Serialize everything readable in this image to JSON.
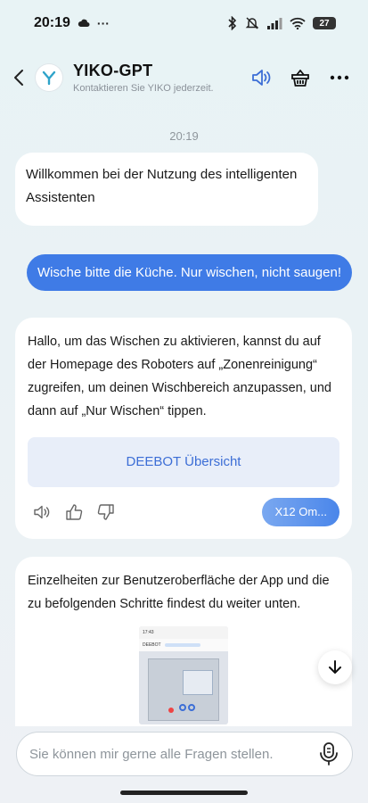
{
  "status_bar": {
    "time": "20:19",
    "battery": "27",
    "dots": "···"
  },
  "header": {
    "title": "YIKO-GPT",
    "subtitle": "Kontaktieren Sie YIKO jederzeit."
  },
  "chat": {
    "timestamp": "20:19",
    "welcome_message": "Willkommen bei der Nutzung des intelligenten Assistenten",
    "user_message": "Wische bitte die Küche. Nur wischen, nicht saugen!",
    "answer": {
      "text": "Hallo, um das Wischen zu aktivieren, kannst du auf der Homepage des Roboters auf „Zonenreinigung“ zugreifen, um deinen Wischbereich anzupassen, und dann auf „Nur Wischen“ tippen.",
      "link_card_label": "DEEBOT Übersicht",
      "device_pill": "X12 Om..."
    },
    "details": {
      "text": "Einzelheiten zur Benutzeroberfläche der App und die zu befolgenden Schritte findest du weiter unten.",
      "thumb_time": "17:43",
      "thumb_title": "DEEBOT"
    }
  },
  "input": {
    "placeholder": "Sie können mir gerne alle Fragen stellen."
  },
  "colors": {
    "accent": "#3f7be6",
    "link": "#3c6ed6",
    "card": "#e8eef9",
    "background": "#e8f3f5"
  },
  "icons": {
    "back": "chevron-left-icon",
    "logo": "yiko-logo-icon",
    "speaker": "speaker-icon",
    "basket": "basket-icon",
    "more": "more-icon",
    "thumbs_up": "thumbs-up-icon",
    "thumbs_down": "thumbs-down-icon",
    "scroll_down": "arrow-down-icon",
    "mic": "microphone-icon"
  }
}
